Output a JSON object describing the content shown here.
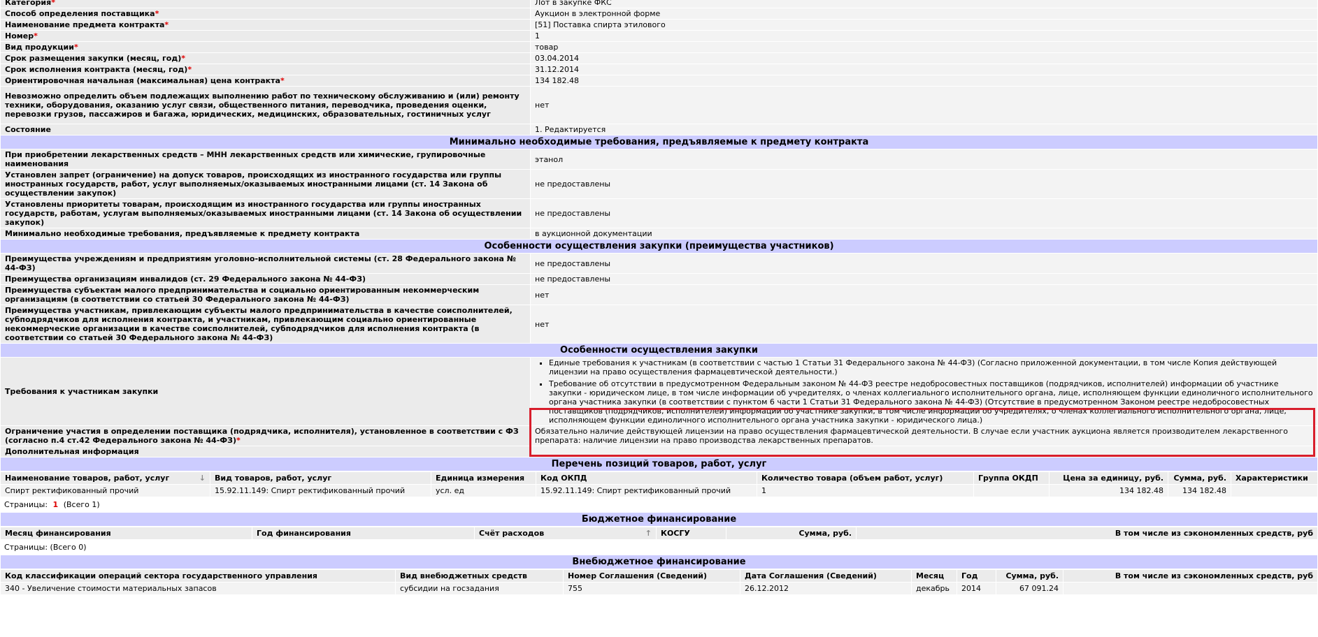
{
  "form": [
    {
      "label": "Категория",
      "req": true,
      "value": "Лот в закупке ФКС"
    },
    {
      "label": "Способ определения поставщика",
      "req": true,
      "value": "Аукцион в электронной форме"
    },
    {
      "label": "Наименование предмета контракта",
      "req": true,
      "value": "[51] Поставка спирта этилового"
    },
    {
      "label": "Номер",
      "req": true,
      "value": "1"
    },
    {
      "label": "Вид продукции",
      "req": true,
      "value": "товар"
    },
    {
      "label": "Срок размещения закупки (месяц, год)",
      "req": true,
      "value": "03.04.2014"
    },
    {
      "label": "Срок исполнения контракта (месяц, год)",
      "req": true,
      "value": "31.12.2014"
    },
    {
      "label": "Ориентировочная начальная (максимальная) цена контракта",
      "req": true,
      "value": "134 182.48"
    },
    {
      "label": "Невозможно определить объем подлежащих выполнению работ по техническому обслуживанию и (или) ремонту техники, оборудования, оказанию услуг связи, общественного питания, переводчика, проведения оценки, перевозки грузов, пассажиров и багажа, юридических, медицинских, образовательных, гостиничных услуг",
      "req": false,
      "value": "нет"
    },
    {
      "label": "Состояние",
      "req": false,
      "value": "1. Редактируется"
    }
  ],
  "section_min_req": "Минимально необходимые требования, предъявляемые к предмету контракта",
  "min_req": [
    {
      "label": "При приобретении лекарственных средств – МНН лекарственных средств или химические, групировочные наименования",
      "value": "этанол"
    },
    {
      "label": "Установлен запрет (ограничение) на допуск товаров, происходящих из иностранного государства или группы иностранных государств, работ, услуг выполняемых/оказываемых иностранными лицами (ст. 14 Закона об осуществлении закупок)",
      "value": "не предоставлены"
    },
    {
      "label": "Установлены приоритеты товарам, происходящим из иностранного государства или группы иностранных государств, работам, услугам выполняемых/оказываемых иностранными лицами (ст. 14 Закона об осуществлении закупок)",
      "value": "не предоставлены"
    },
    {
      "label": "Минимально необходимые требования, предъявляемые к предмету контракта",
      "value": "в аукционной документации"
    }
  ],
  "section_adv": "Особенности осуществления закупки (преимущества участников)",
  "adv": [
    {
      "label": "Преимущества учреждениям и предприятиям уголовно-исполнительной системы (ст. 28 Федерального закона № 44-ФЗ)",
      "value": "не предоставлены"
    },
    {
      "label": "Преимущества организациям инвалидов (ст. 29 Федерального закона № 44-ФЗ)",
      "value": "не предоставлены"
    },
    {
      "label": "Преимущества субъектам малого предпринимательства и социально ориентированным некоммерческим организациям (в соответствии со статьей 30 Федерального закона № 44-ФЗ)",
      "value": "нет"
    },
    {
      "label": "Преимущества участникам, привлекающим субъекты малого предпринимательства в качестве соисполнителей, субподрядчиков для исполнения контракта, и участникам, привлекающим социально ориентированные некоммерческие организации в качестве соисполнителей, субподрядчиков для исполнения контракта (в соответствии со статьей 30 Федерального закона № 44-ФЗ)",
      "value": "нет"
    }
  ],
  "section_features": "Особенности осуществления закупки",
  "participant_req": {
    "label": "Требования к участникам закупки",
    "items": [
      "Единые требования к участникам (в соответствии с частью 1 Статьи 31 Федерального закона № 44-ФЗ) (Согласно приложенной документации, в том числе Копия действующей лицензии на право осуществления фармацевтической деятельности.)",
      "Требование об отсутствии в предусмотренном Федеральным законом № 44-ФЗ реестре недобросовестных поставщиков (подрядчиков, исполнителей) информации об участнике закупки - юридическом лице, в том числе информации об учредителях, о членах коллегиального исполнительного органа, лице, исполняющем функции единоличного исполнительного органа участника закупки (в соответствии с пунктом 6 части 1 Статьи 31 Федерального закона № 44-ФЗ) (Отсутствие в предусмотренном Законом реестре недобросовестных поставщиков (подрядчиков, исполнителей) информации об участнике закупки, в том числе информации об учредителях, о членах коллегиального исполнительного органа, лице, исполняющем функции единоличного исполнительного органа участника закупки - юридического лица.)"
    ]
  },
  "restriction": {
    "label": "Ограничение участия в определении поставщика (подрядчика, исполнителя), установленное в соответствии с ФЗ (согласно п.4 ст.42 Федерального закона № 44-ФЗ)",
    "value": "Обязательно наличие действующей лицензии на право осуществления фармацевтической деятельности. В случае если участник аукциона является производителем лекарственного препарата: наличие лицензии на право производства лекарственных препаратов."
  },
  "additional": {
    "label": "Дополнительная информация",
    "value": ""
  },
  "goods": {
    "title": "Перечень позиций товаров, работ, услуг",
    "headers": [
      "Наименование товаров, работ, услуг",
      "Вид товаров, работ, услуг",
      "Единица измерения",
      "Код ОКПД",
      "Количество товара (объем работ, услуг)",
      "Группа ОКДП",
      "Цена за единицу, руб.",
      "Сумма, руб.",
      "Характеристики"
    ],
    "rows": [
      [
        "Спирт ректификованный прочий",
        "15.92.11.149: Спирт ректификованный прочий",
        "усл. ед",
        "15.92.11.149: Спирт ректификованный прочий",
        "1",
        "",
        "134 182.48",
        "134 182.48",
        ""
      ]
    ],
    "pager": {
      "label": "Страницы:",
      "current": "1",
      "total": "(Всего 1)"
    }
  },
  "budget": {
    "title": "Бюджетное финансирование",
    "headers": [
      "Месяц финансирования",
      "Год финансирования",
      "Счёт расходов",
      "КОСГУ",
      "Сумма, руб.",
      "В том числе из сэкономленных средств, руб"
    ],
    "pager": {
      "label": "Страницы:",
      "total": "(Всего 0)"
    }
  },
  "offbudget": {
    "title": "Внебюджетное финансирование",
    "headers": [
      "Код классификации операций сектора государственного управления",
      "Вид внебюджетных средств",
      "Номер Соглашения (Сведений)",
      "Дата Соглашения (Сведений)",
      "Месяц",
      "Год",
      "Сумма, руб.",
      "В том числе из сэкономленных средств, руб"
    ],
    "rows": [
      [
        "340 - Увеличение стоимости материальных запасов",
        "субсидии на госзадания",
        "755",
        "26.12.2012",
        "декабрь",
        "2014",
        "67 091.24",
        ""
      ]
    ]
  },
  "icons": {
    "sort_down": "↓",
    "sort_up": "↑"
  }
}
